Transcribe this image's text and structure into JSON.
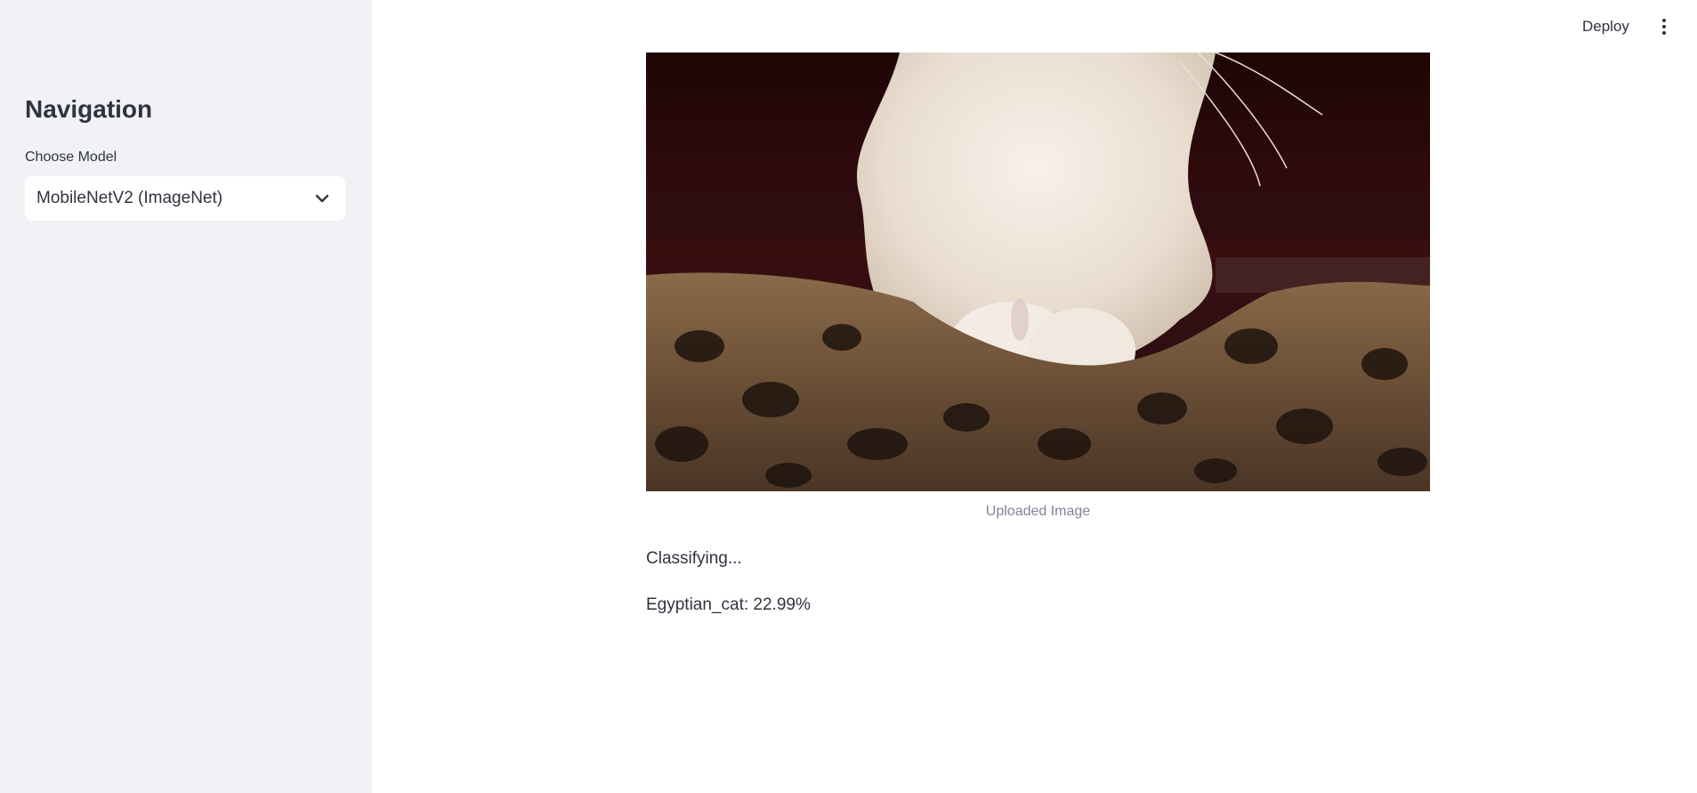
{
  "header": {
    "deploy_label": "Deploy",
    "menu_icon": "vertical-dots-icon"
  },
  "sidebar": {
    "title": "Navigation",
    "model_select": {
      "label": "Choose Model",
      "value": "MobileNetV2 (ImageNet)",
      "icon": "chevron-down-icon"
    }
  },
  "main": {
    "image_caption": "Uploaded Image",
    "status": "Classifying...",
    "result": "Egyptian_cat: 22.99%"
  },
  "colors": {
    "sidebar_bg": "#f0f2f6",
    "text": "#31333f",
    "caption": "#808495"
  }
}
